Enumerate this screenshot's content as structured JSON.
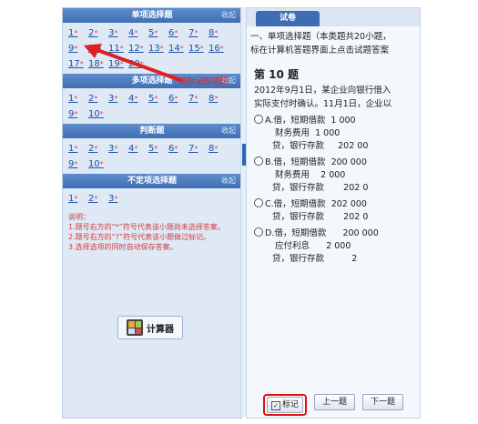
{
  "sections": [
    {
      "title": "单项选择题",
      "collapse": "收起",
      "questions": [
        "1",
        "2",
        "3",
        "4",
        "5",
        "6",
        "7",
        "8",
        "9",
        "10",
        "11",
        "12",
        "13",
        "14",
        "15",
        "16",
        "17",
        "18",
        "19",
        "20"
      ],
      "flagged": [
        "10"
      ]
    },
    {
      "title": "多项选择题",
      "collapse": "收起",
      "questions": [
        "1",
        "2",
        "3",
        "4",
        "5",
        "6",
        "7",
        "8",
        "9",
        "10"
      ]
    },
    {
      "title": "判断题",
      "collapse": "收起",
      "questions": [
        "1",
        "2",
        "3",
        "4",
        "5",
        "6",
        "7",
        "8",
        "9",
        "10"
      ]
    },
    {
      "title": "不定项选择题",
      "collapse": "收起",
      "questions": [
        "1",
        "2",
        "3"
      ]
    }
  ],
  "star": "*",
  "annotation": "被标记的试题",
  "notes": {
    "heading": "说明：",
    "line1": "1.题号右方的“*”符号代表该小题尚未选择答案。",
    "line2": "2.题号右方的“?”符号代表该小题做过标记。",
    "line3": "3.选择选项的同时自动保存答案。"
  },
  "calculator_label": "计算器",
  "exam_tab": "试卷",
  "section_intro": [
    "一、单项选择题（本类题共20小题，",
    "标在计算机答题界面上点击试题答案"
  ],
  "question": {
    "number": "第 10 题",
    "stem": [
      "2012年9月1日，某企业向银行借入",
      "实际支付时确认。11月1日，企业以"
    ],
    "options": [
      {
        "letter": "A.",
        "lines": [
          "借，短期借款  1 000",
          "   财务费用  1 000",
          "  贷，银行存款     202 00"
        ]
      },
      {
        "letter": "B.",
        "lines": [
          "借，短期借款  200 000",
          "   财务费用    2 000",
          "  贷，银行存款       202 0"
        ]
      },
      {
        "letter": "C.",
        "lines": [
          "借，短期借款  202 000",
          "  贷，银行存款       202 0"
        ]
      },
      {
        "letter": "D.",
        "lines": [
          "借，短期借款      200 000",
          "   应付利息      2 000",
          "  贷，银行存款          2"
        ]
      }
    ]
  },
  "buttons": {
    "mark": "标记",
    "prev": "上一题",
    "next": "下一题",
    "mark_checked": "✓"
  }
}
